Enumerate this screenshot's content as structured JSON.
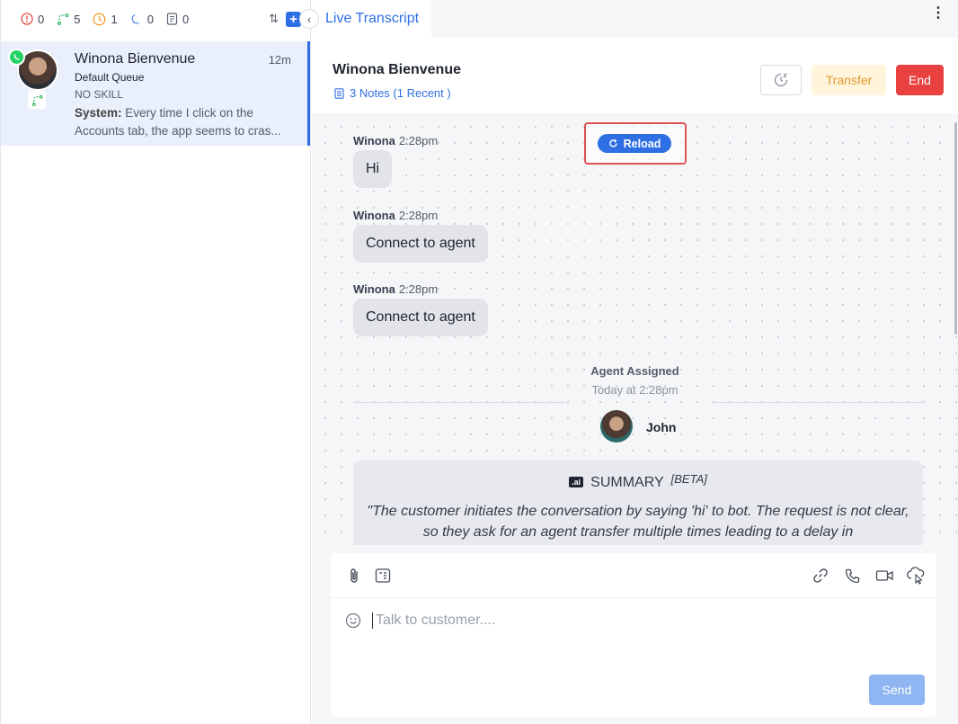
{
  "status_bar": {
    "stats": [
      {
        "icon": "alert-circle-icon",
        "count": "0",
        "color": "#e04a4a"
      },
      {
        "icon": "route-icon",
        "count": "5",
        "color": "#2fb45a"
      },
      {
        "icon": "clock-icon",
        "count": "1",
        "color": "#f29b27"
      },
      {
        "icon": "moon-icon",
        "count": "0",
        "color": "#5b8def"
      },
      {
        "icon": "note-icon",
        "count": "0",
        "color": "#5b6372"
      }
    ],
    "sort_glyph": "⇅",
    "add_glyph": "+"
  },
  "conversation": {
    "name": "Winona Bienvenue",
    "time": "12m",
    "queue": "Default Queue",
    "skill": "NO SKILL",
    "preview_label": "System:",
    "preview_text": " Every time I click on the Accounts tab, the app seems to cras..."
  },
  "tab": {
    "label": "Live Transcript",
    "collapse_glyph": "‹",
    "menu_glyph": "⋮"
  },
  "header": {
    "name": "Winona Bienvenue",
    "notes": "3 Notes (1 Recent )",
    "transfer_label": "Transfer",
    "end_label": "End"
  },
  "reload": {
    "label": "Reload"
  },
  "messages": [
    {
      "sender": "Winona",
      "time": "2:28pm",
      "text": "Hi"
    },
    {
      "sender": "Winona",
      "time": "2:28pm",
      "text": "Connect to agent"
    },
    {
      "sender": "Winona",
      "time": "2:28pm",
      "text": "Connect to agent"
    }
  ],
  "assignment": {
    "title": "Agent Assigned",
    "time": "Today at 2:28pm",
    "agent": "John"
  },
  "summary": {
    "badge": ".ai",
    "title": "SUMMARY",
    "beta": "[BETA]",
    "text": "\"The customer initiates the conversation by saying 'hi' to bot. The request is not clear, so they ask for an agent transfer multiple times leading to a delay in"
  },
  "composer": {
    "placeholder": "Talk to customer....",
    "send_label": "Send"
  },
  "colors": {
    "accent": "#2f6fe4",
    "end": "#e94040",
    "transfer_bg": "#fff5dd",
    "transfer_text": "#e39a2a",
    "highlight_box": "#e05252"
  }
}
